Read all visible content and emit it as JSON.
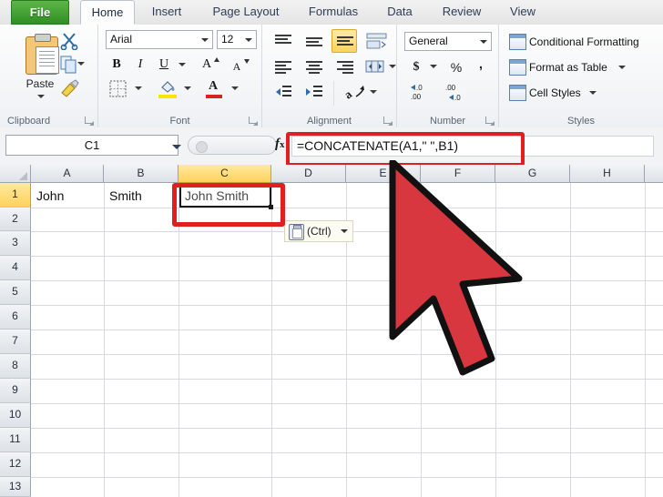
{
  "app": {
    "title": "Microsoft Excel 2010",
    "accent_green": "#2f8f22",
    "highlight_red": "#e02020",
    "selection_yellow": "#ffd25c"
  },
  "ribbon": {
    "tabs": [
      {
        "label": "File",
        "state": "file"
      },
      {
        "label": "Home",
        "state": "active"
      },
      {
        "label": "Insert",
        "state": "plain"
      },
      {
        "label": "Page Layout",
        "state": "plain"
      },
      {
        "label": "Formulas",
        "state": "plain"
      },
      {
        "label": "Data",
        "state": "plain"
      },
      {
        "label": "Review",
        "state": "plain"
      },
      {
        "label": "View",
        "state": "plain"
      }
    ],
    "groups": {
      "clipboard": {
        "label": "Clipboard",
        "paste_label": "Paste",
        "cut_icon": "scissors-icon",
        "copy_icon": "copy-icon",
        "format_painter_icon": "paintbrush-icon",
        "launcher_icon": "dialog-launcher-icon"
      },
      "font": {
        "label": "Font",
        "font_name": "Arial",
        "font_size": "12",
        "bold_label": "B",
        "italic_label": "I",
        "underline_label": "U",
        "grow_font_label": "A",
        "shrink_font_label": "A",
        "borders_icon": "borders-icon",
        "fill_color_icon": "fill-color-icon",
        "font_color_label": "A",
        "launcher_icon": "dialog-launcher-icon"
      },
      "alignment": {
        "label": "Alignment",
        "top_align_icon": "align-top-icon",
        "middle_align_icon": "align-middle-icon",
        "bottom_align_icon": "align-bottom-icon",
        "wrap_text_icon": "wrap-text-icon",
        "align_left_icon": "align-left-icon",
        "align_center_icon": "align-center-icon",
        "align_right_icon": "align-right-icon",
        "merge_center_icon": "merge-center-icon",
        "decrease_indent_icon": "decrease-indent-icon",
        "increase_indent_icon": "increase-indent-icon",
        "orientation_icon": "orientation-icon",
        "active_button": "bottom-align",
        "launcher_icon": "dialog-launcher-icon"
      },
      "number": {
        "label": "Number",
        "format": "General",
        "currency_label": "$",
        "percent_label": "%",
        "comma_label": ",",
        "increase_decimal_label": ".0",
        "decrease_decimal_label": ".00",
        "launcher_icon": "dialog-launcher-icon"
      },
      "styles": {
        "label": "Styles",
        "items": [
          {
            "label": "Conditional Formatting",
            "icon": "conditional-formatting-icon",
            "caret": false
          },
          {
            "label": "Format as Table",
            "icon": "format-as-table-icon",
            "caret": true
          },
          {
            "label": "Cell Styles",
            "icon": "cell-styles-icon",
            "caret": true
          }
        ]
      }
    }
  },
  "formula_bar": {
    "name_box": "C1",
    "fx_label": "fx",
    "formula": "=CONCATENATE(A1,\" \",B1)",
    "expand_icon": "expand-formula-bar-icon",
    "name_box_caret_icon": "chevron-down-icon",
    "highlighted": true
  },
  "sheet": {
    "columns": [
      "A",
      "B",
      "C",
      "D",
      "E",
      "F",
      "G",
      "H"
    ],
    "selected_column": "C",
    "rows": [
      "1",
      "2",
      "3",
      "4",
      "5",
      "6",
      "7",
      "8",
      "9",
      "10",
      "11",
      "12",
      "13"
    ],
    "selected_row": "1",
    "cells": [
      {
        "ref": "A1",
        "value": "John"
      },
      {
        "ref": "B1",
        "value": "Smith"
      },
      {
        "ref": "C1",
        "value": "John Smith"
      }
    ],
    "active_cell": "C1",
    "active_cell_value": "John Smith",
    "paste_options": {
      "label": "(Ctrl)",
      "icon": "paste-options-icon",
      "caret_icon": "chevron-down-icon"
    }
  },
  "annotations": {
    "cursor_arrow": {
      "icon": "mouse-cursor-arrow",
      "color": "#d8373f"
    },
    "formula_highlight_color": "#e02020",
    "cell_highlight_color": "#e02020"
  }
}
